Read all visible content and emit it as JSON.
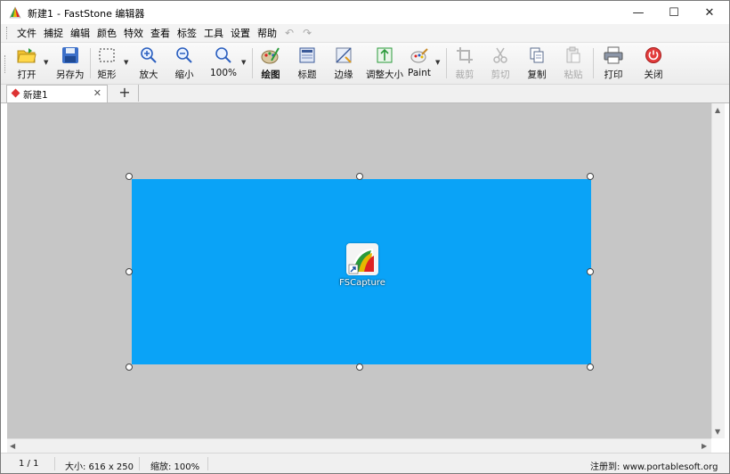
{
  "window": {
    "title": "新建1",
    "app_name": "FastStone 编辑器",
    "sep": "-",
    "minimize": "—",
    "maximize": "☐",
    "close": "✕"
  },
  "menu": [
    "文件",
    "捕捉",
    "编辑",
    "颜色",
    "特效",
    "查看",
    "标签",
    "工具",
    "设置",
    "帮助"
  ],
  "toolbar": {
    "open": "打开",
    "save_as": "另存为",
    "rectangle": "矩形",
    "zoom_in": "放大",
    "zoom_out": "缩小",
    "zoom_level": "100%",
    "draw": "绘图",
    "caption": "标题",
    "edge": "边缘",
    "resize": "调整大小",
    "paint": "Paint",
    "crop": "裁剪",
    "cut": "剪切",
    "copy": "复制",
    "paste": "粘贴",
    "print": "打印",
    "close": "关闭"
  },
  "tabs": [
    {
      "label": "新建1",
      "close": "✕"
    }
  ],
  "tab_add": "+",
  "canvas": {
    "image_bg": "#0aa3f7",
    "desktop_icon_label": "FSCapture"
  },
  "status": {
    "page": "1 / 1",
    "size": "大小: 616 x 250",
    "zoom": "缩放: 100%",
    "registered": "注册到: www.portablesoft.org"
  }
}
